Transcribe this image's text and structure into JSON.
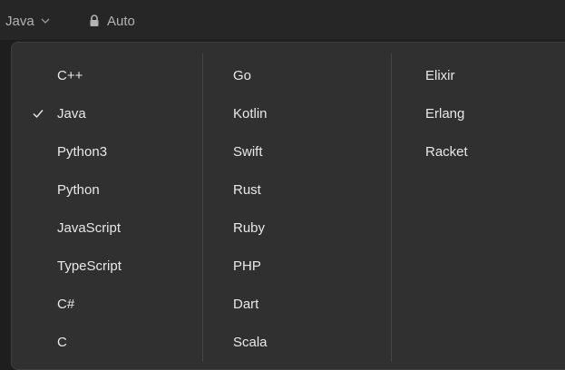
{
  "toolbar": {
    "language": "Java",
    "mode": "Auto"
  },
  "languages": {
    "column1": [
      "C++",
      "Java",
      "Python3",
      "Python",
      "JavaScript",
      "TypeScript",
      "C#",
      "C"
    ],
    "column2": [
      "Go",
      "Kotlin",
      "Swift",
      "Rust",
      "Ruby",
      "PHP",
      "Dart",
      "Scala"
    ],
    "column3": [
      "Elixir",
      "Erlang",
      "Racket"
    ],
    "selected": "Java"
  },
  "icons": {
    "selector": "chevron-down-icon",
    "mode": "lock-icon",
    "selected": "check-icon"
  },
  "colors": {
    "background": "#1e1e1e",
    "menu": "#303030",
    "text": "#e8e8e8",
    "muted": "#b3b3b3"
  }
}
